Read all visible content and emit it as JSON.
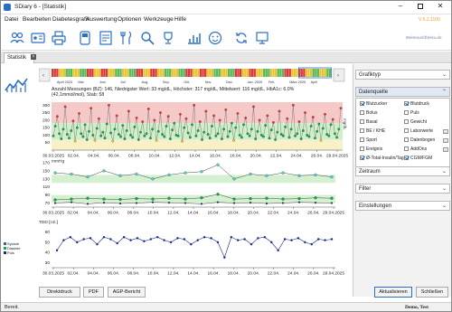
{
  "window": {
    "title": "SDiary 6 - [Statistik]",
    "version": "V 6.2.1100",
    "logo_text": "Meltemstiftdeta.de"
  },
  "menu": [
    "Datei",
    "Bearbeiten",
    "Diabetesgrafik",
    "Auswertung",
    "Optionen",
    "Werkzeuge",
    "Hilfe"
  ],
  "toolbar_icons": [
    "people-icon",
    "id-card-icon",
    "printer-icon",
    "glucose-meter-icon",
    "report-icon",
    "food-icon",
    "search-icon",
    "trophy-icon",
    "chart-icon",
    "smiley-icon",
    "sync-icon",
    "device-icon"
  ],
  "tab": {
    "label": "Statistik"
  },
  "timeline": {
    "labels": [
      "April 2024",
      "Mai",
      "Juni",
      "Juli",
      "Aug.",
      "Sep.",
      "Okt.",
      "Nov.",
      "Dez.",
      "Jan. 2025",
      "Feb.",
      "März 2025",
      "April"
    ]
  },
  "chart1": {
    "summary_line1": "Anzahl Messungen (BZ): 146, Niedrigster Wert: 33 mg/dL, Höchster: 317 mg/dL, Mittelwert: 116 mg/dL, HbA1c: 6.0%",
    "summary_line2": "(42,1mmol/mol), Stab: 58",
    "unit": "mg/dL"
  },
  "chart2": {
    "unit": "mmHg"
  },
  "chart3": {
    "unit": "TDD [I.E.]"
  },
  "legend": {
    "systole": "Systole",
    "diastole": "Diastole",
    "pulse": "Puls"
  },
  "chart_data": [
    {
      "type": "scatter",
      "title": "",
      "ylabel": "mg/dL",
      "ylim": [
        0,
        320
      ],
      "yticks": [
        "50",
        "100",
        "150",
        "200",
        "250",
        "300"
      ],
      "x_tick_labels": [
        "30.03.2025",
        "02.04.",
        "04.04.",
        "06.04.",
        "08.04.",
        "10.04.",
        "12.04.",
        "14.04.",
        "16.04.",
        "18.04.",
        "20.04.",
        "22.04.",
        "24.04.",
        "26.04.",
        "29.04.2025"
      ],
      "target_band": [
        70,
        180
      ],
      "series": [
        {
          "values": [
            95,
            160,
            225,
            110,
            75,
            140,
            290,
            105,
            80,
            130,
            195,
            60,
            150,
            245,
            110,
            90,
            170,
            70,
            125,
            280,
            100,
            65,
            145,
            210,
            95,
            120,
            80,
            175,
            300,
            115,
            60,
            140,
            230,
            105,
            90,
            165,
            75,
            130,
            260,
            100,
            85,
            155,
            215,
            70,
            120,
            190,
            95,
            110,
            275,
            80,
            140,
            200,
            65,
            125,
            250,
            105,
            90,
            160,
            225,
            75,
            135,
            180,
            100,
            95,
            240,
            60,
            150,
            210,
            115,
            85,
            170,
            300,
            95,
            130,
            190,
            70,
            120,
            260,
            105,
            80,
            160,
            230,
            95,
            110,
            200,
            75,
            140,
            270,
            90,
            125,
            180,
            65,
            150,
            245,
            100,
            85,
            170,
            215,
            110,
            95,
            140,
            290,
            75,
            125,
            200,
            100,
            90,
            165,
            230,
            80,
            135,
            185,
            70,
            120,
            260,
            105,
            95,
            155,
            210,
            85,
            140,
            300,
            95,
            110,
            190,
            75,
            130,
            250,
            100,
            90,
            160,
            220,
            80,
            125,
            175,
            65,
            145,
            240,
            105,
            95,
            170,
            205,
            110,
            85,
            140,
            280
          ]
        }
      ]
    },
    {
      "type": "line",
      "title": "",
      "ylabel": "mmHg",
      "ylim": [
        60,
        170
      ],
      "yticks": [
        "70",
        "90",
        "110",
        "130",
        "150",
        "170"
      ],
      "x_tick_labels": [
        "30.03.2025",
        "02.04.",
        "04.04.",
        "06.04.",
        "08.04.",
        "10.04.",
        "12.04.",
        "14.04.",
        "16.04.",
        "18.04.",
        "20.04.",
        "22.04.",
        "24.04.",
        "26.04.",
        "29.04.2025"
      ],
      "series": [
        {
          "name": "Systole",
          "values": [
            145,
            142,
            135,
            150,
            138,
            142,
            130,
            140,
            145,
            148,
            165,
            130,
            142,
            138,
            145,
            138,
            140,
            135
          ]
        },
        {
          "name": "Diastole",
          "values": [
            78,
            80,
            82,
            80,
            79,
            81,
            80,
            82,
            80,
            83,
            92,
            80,
            81,
            82,
            80,
            81,
            83,
            82
          ]
        },
        {
          "name": "Puls",
          "values": [
            70,
            72,
            68,
            71,
            69,
            70,
            72,
            71,
            70,
            68,
            72,
            70,
            71,
            69,
            70,
            72,
            71,
            70
          ]
        }
      ]
    },
    {
      "type": "line",
      "title": "",
      "ylabel": "TDD [I.E.]",
      "ylim": [
        25,
        65
      ],
      "yticks": [
        "30",
        "40",
        "50",
        "60"
      ],
      "x_tick_labels": [
        "30.03.2025",
        "02.04.",
        "04.04.",
        "06.04.",
        "08.04.",
        "10.04.",
        "12.04.",
        "14.04.",
        "16.04.",
        "18.04.",
        "20.04.",
        "22.04.",
        "24.04.",
        "26.04.",
        "29.04.2025"
      ],
      "series": [
        {
          "values": [
            42,
            52,
            55,
            50,
            53,
            54,
            48,
            55,
            53,
            49,
            55,
            52,
            54,
            51,
            53,
            55,
            52,
            50,
            54,
            53,
            48,
            52,
            55,
            54,
            50,
            35,
            55,
            52,
            53,
            48,
            54,
            55,
            50,
            42,
            53,
            52,
            54,
            50,
            48,
            53,
            52,
            53
          ]
        }
      ]
    }
  ],
  "right_panel": {
    "graph_type": "Grafiktyp",
    "data_source": "Datenquelle",
    "checkboxes_left": [
      {
        "label": "Blutzucker",
        "on": true
      },
      {
        "label": "Bolus",
        "on": false
      },
      {
        "label": "Basal",
        "on": false
      },
      {
        "label": "BE / KHE",
        "on": false
      },
      {
        "label": "Sport",
        "on": false
      },
      {
        "label": "Ereignis",
        "on": false
      },
      {
        "label": "Ø-Total-Insulin/Tag",
        "on": true
      }
    ],
    "checkboxes_right": [
      {
        "label": "Blutdruck",
        "on": true
      },
      {
        "label": "Puls",
        "on": false
      },
      {
        "label": "Gewicht",
        "on": false
      },
      {
        "label": "Laborwerte",
        "on": false
      },
      {
        "label": "Datenbogen",
        "on": false
      },
      {
        "label": "AddOns",
        "on": false
      },
      {
        "label": "CGM/FGM",
        "on": true
      }
    ],
    "time_range": "Zeitraum",
    "filter": "Filter",
    "settings": "Einstellungen"
  },
  "buttons": {
    "direct_print": "Direktdruck",
    "pdf": "PDF",
    "agp": "AGP-Bericht",
    "refresh": "Aktualisieren",
    "close": "Schließen"
  },
  "status": {
    "left": "Bereit.",
    "right": "Demo, Test"
  }
}
